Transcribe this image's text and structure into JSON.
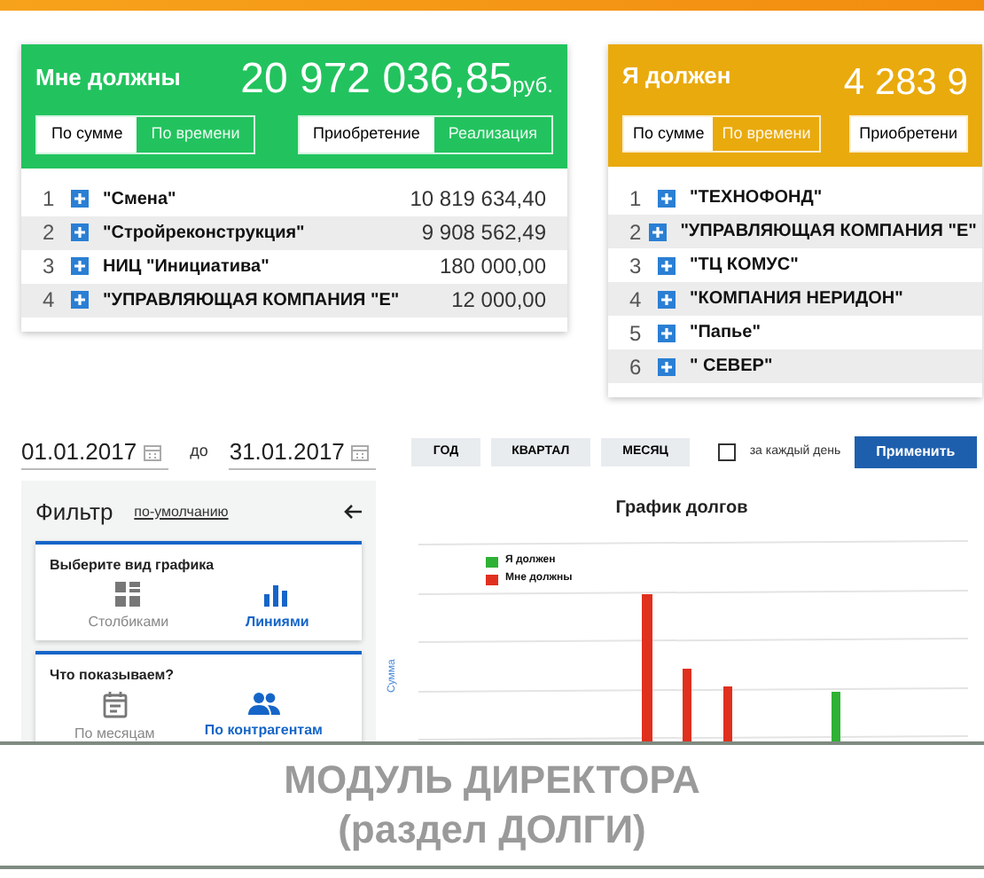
{
  "debt_cards": [
    {
      "title": "Мне должны",
      "amount": "20 972 036,85",
      "currency": "руб.",
      "color": "#22c35e",
      "mode_tabs": [
        {
          "label": "По сумме",
          "selected": true
        },
        {
          "label": "По времени",
          "selected": false
        }
      ],
      "type_tabs": [
        {
          "label": "Приобретение",
          "selected": true
        },
        {
          "label": "Реализация",
          "selected": false
        }
      ],
      "rows": [
        {
          "index": "1",
          "name": "\"Смена\"",
          "amount": "10 819 634,40"
        },
        {
          "index": "2",
          "name": "\"Стройреконструкция\"",
          "amount": "9 908 562,49"
        },
        {
          "index": "3",
          "name": "НИЦ \"Инициатива\"",
          "amount": "180 000,00"
        },
        {
          "index": "4",
          "name": "\"УПРАВЛЯЮЩАЯ КОМПАНИЯ \"Е\"",
          "amount": "12 000,00"
        }
      ]
    },
    {
      "title": "Я должен",
      "amount": "4 283 9",
      "color": "#e9aa0d",
      "mode_tabs": [
        {
          "label": "По сумме",
          "selected": true
        },
        {
          "label": "По времени",
          "selected": false
        }
      ],
      "type_tabs": [
        {
          "label": "Приобретени",
          "selected": true
        }
      ],
      "rows": [
        {
          "index": "1",
          "name": "\"ТЕХНОФОНД\""
        },
        {
          "index": "2",
          "name": "\"УПРАВЛЯЮЩАЯ КОМПАНИЯ \"Е\""
        },
        {
          "index": "3",
          "name": "\"ТЦ КОМУС\""
        },
        {
          "index": "4",
          "name": "\"КОМПАНИЯ НЕРИДОН\""
        },
        {
          "index": "5",
          "name": "\"Папье\""
        },
        {
          "index": "6",
          "name": "\" СЕВЕР\""
        }
      ]
    }
  ],
  "period": {
    "date_from": "01.01.2017",
    "separator": "до",
    "date_to": "31.01.2017",
    "period_buttons": [
      "ГОД",
      "КВАРТАЛ",
      "МЕСЯЦ"
    ],
    "daily": {
      "label": "за каждый день",
      "checked": false
    },
    "apply": "Применить"
  },
  "filter": {
    "title": "Фильтр",
    "reset_link": "по-умолчанию",
    "sections": [
      {
        "title": "Выберите вид графика",
        "options": [
          {
            "label": "Столбиками",
            "kind": "grid",
            "selected": false
          },
          {
            "label": "Линиями",
            "kind": "bars",
            "selected": true
          }
        ]
      },
      {
        "title": "Что показываем?",
        "options": [
          {
            "label": "По месяцам",
            "kind": "calendar",
            "selected": false
          },
          {
            "label": "По контрагентам",
            "kind": "people",
            "selected": true
          }
        ]
      }
    ]
  },
  "chart": {
    "title": "График долгов",
    "legend": [
      {
        "label": "Я должен",
        "color": "#2eb135"
      },
      {
        "label": "Мне должны",
        "color": "#e0301e"
      }
    ],
    "ylabel": "Сумма"
  },
  "caption": [
    "МОДУЛЬ ДИРЕКТОРА",
    "(раздел ДОЛГИ)"
  ]
}
